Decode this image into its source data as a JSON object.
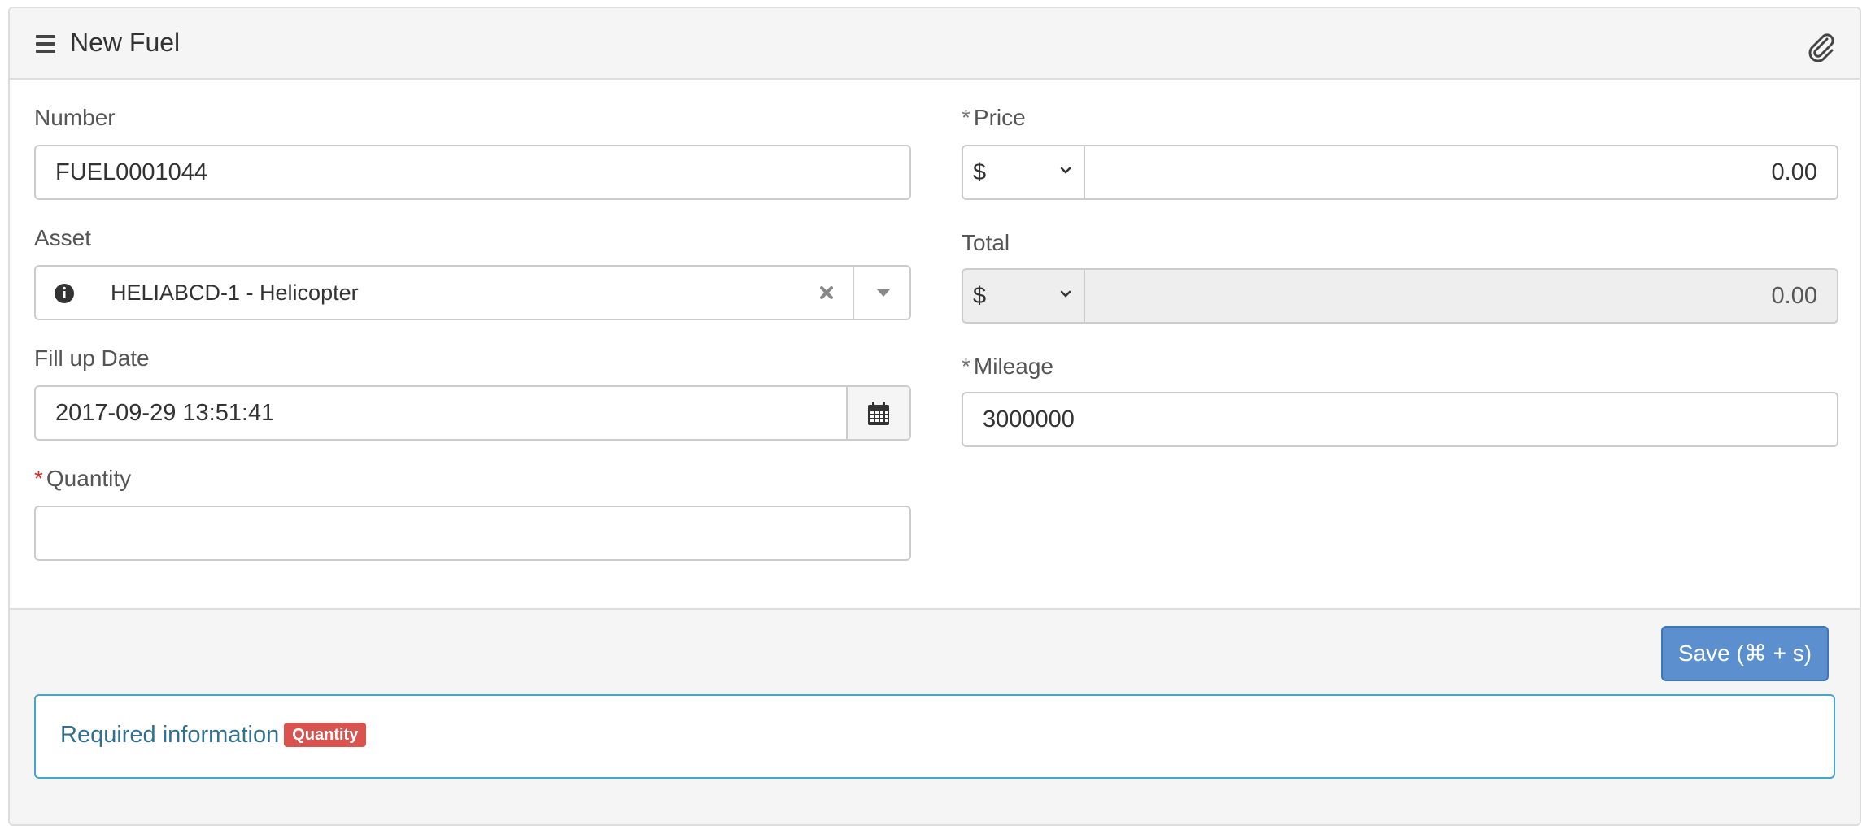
{
  "header": {
    "title": "New Fuel",
    "menu_icon": "bars-icon",
    "attach_icon": "paperclip-icon"
  },
  "form": {
    "number": {
      "label": "Number",
      "value": "FUEL0001044"
    },
    "asset": {
      "label": "Asset",
      "value": "HELIABCD-1 - Helicopter"
    },
    "fill_up_date": {
      "label": "Fill up Date",
      "value": "2017-09-29 13:51:41"
    },
    "quantity": {
      "label": "Quantity",
      "required_mark": "*",
      "value": ""
    },
    "price": {
      "label": "Price",
      "required_mark": "*",
      "currency": "$",
      "value": "0.00"
    },
    "total": {
      "label": "Total",
      "currency": "$",
      "value": "0.00"
    },
    "mileage": {
      "label": "Mileage",
      "required_mark": "*",
      "value": "3000000"
    }
  },
  "footer": {
    "save_label": "Save (⌘ + s)",
    "alert_text": "Required information",
    "alert_badge": "Quantity"
  },
  "colors": {
    "primary": "#5b8fcd",
    "danger": "#d9534f",
    "info": "#31708f"
  }
}
